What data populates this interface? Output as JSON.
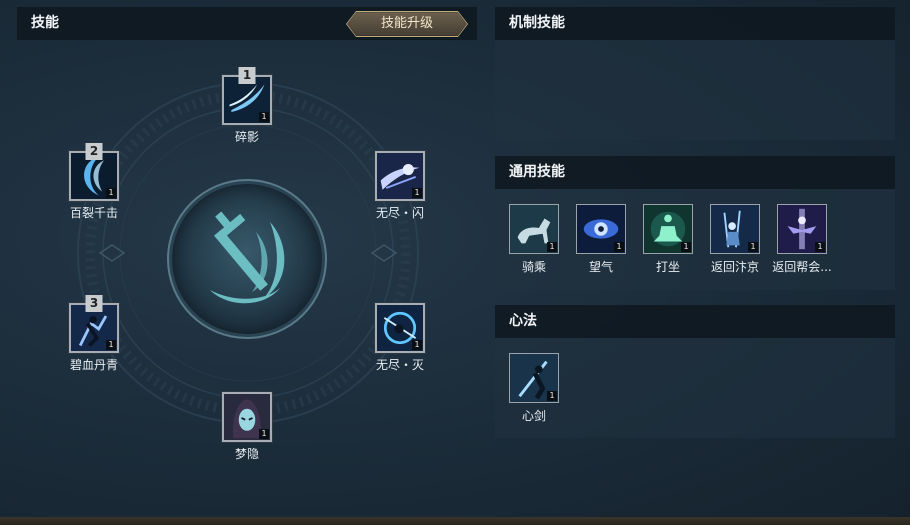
{
  "left_panel": {
    "title": "技能",
    "upgrade_button": "技能升级",
    "skills": [
      {
        "slot": "1",
        "name": "碎影",
        "level": "1",
        "icon": "crescent-slash-icon"
      },
      {
        "slot": "2",
        "name": "百裂千击",
        "level": "1",
        "icon": "blue-arc-icon"
      },
      {
        "slot": "",
        "name": "无尽・闪",
        "level": "1",
        "icon": "spectral-flash-icon"
      },
      {
        "slot": "3",
        "name": "碧血丹青",
        "level": "1",
        "icon": "swordsman-leap-icon"
      },
      {
        "slot": "",
        "name": "无尽・灭",
        "level": "1",
        "icon": "vortex-strike-icon"
      },
      {
        "slot": "",
        "name": "梦隐",
        "level": "1",
        "icon": "hooded-face-icon"
      }
    ],
    "center_emblem": "sword-crescent-emblem-icon"
  },
  "mechanic_panel": {
    "title": "机制技能"
  },
  "common_panel": {
    "title": "通用技能",
    "skills": [
      {
        "name": "骑乘",
        "level": "1",
        "icon": "horse-icon"
      },
      {
        "name": "望气",
        "level": "1",
        "icon": "eye-icon"
      },
      {
        "name": "打坐",
        "level": "1",
        "icon": "meditation-icon"
      },
      {
        "name": "返回汴京",
        "level": "1",
        "icon": "return-city-icon"
      },
      {
        "name": "返回帮会...",
        "level": "1",
        "icon": "return-guild-icon"
      }
    ]
  },
  "xinfa_panel": {
    "title": "心法",
    "skills": [
      {
        "name": "心剑",
        "level": "1",
        "icon": "heart-sword-icon"
      }
    ]
  }
}
